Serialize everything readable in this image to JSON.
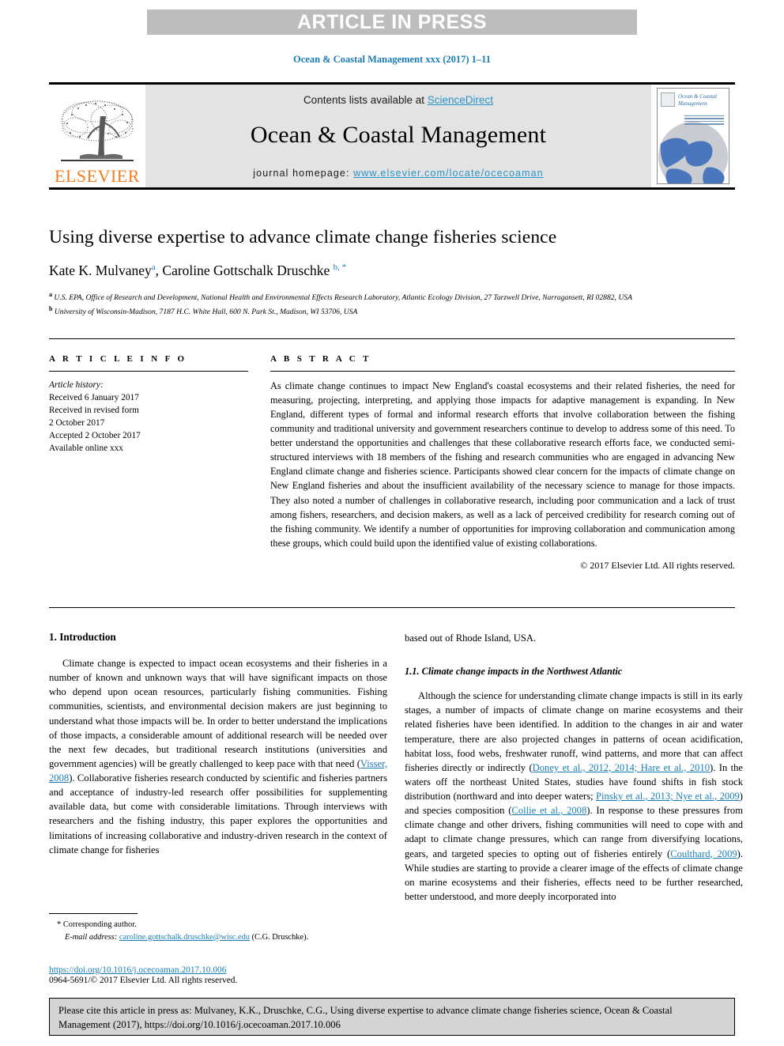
{
  "banner": {
    "text": "ARTICLE IN PRESS"
  },
  "running_head": "Ocean & Coastal Management xxx (2017) 1–11",
  "masthead": {
    "publisher_name": "ELSEVIER",
    "contents_prefix": "Contents lists available at ",
    "sciencedirect": "ScienceDirect",
    "journal_title": "Ocean & Coastal Management",
    "homepage_prefix": "journal homepage: ",
    "homepage_url": "www.elsevier.com/locate/ocecoaman",
    "cover_title": "Ocean & Coastal Management"
  },
  "article": {
    "title": "Using diverse expertise to advance climate change fisheries science",
    "authors": "Kate K. Mulvaney, Caroline Gottschalk Druschke",
    "author_1_name": "Kate K. Mulvaney",
    "author_1_sup": "a",
    "author_2_name": "Caroline Gottschalk Druschke",
    "author_2_sup": "b, *",
    "affiliation_a_marker": "a",
    "affiliation_a": "U.S. EPA, Office of Research and Development, National Health and Environmental Effects Research Laboratory, Atlantic Ecology Division, 27 Tarzwell Drive, Narragansett, RI 02882, USA",
    "affiliation_b_marker": "b",
    "affiliation_b": "University of Wisconsin-Madison, 7187 H.C. White Hall, 600 N. Park St., Madison, WI 53706, USA"
  },
  "article_info": {
    "label": "A R T I C L E   I N F O",
    "history_heading": "Article history:",
    "received": "Received 6 January 2017",
    "revised_line1": "Received in revised form",
    "revised_line2": "2 October 2017",
    "accepted": "Accepted 2 October 2017",
    "available": "Available online xxx"
  },
  "abstract": {
    "label": "A B S T R A C T",
    "text": "As climate change continues to impact New England's coastal ecosystems and their related fisheries, the need for measuring, projecting, interpreting, and applying those impacts for adaptive management is expanding. In New England, different types of formal and informal research efforts that involve collaboration between the fishing community and traditional university and government researchers continue to develop to address some of this need. To better understand the opportunities and challenges that these collaborative research efforts face, we conducted semi-structured interviews with 18 members of the fishing and research communities who are engaged in advancing New England climate change and fisheries science. Participants showed clear concern for the impacts of climate change on New England fisheries and about the insufficient availability of the necessary science to manage for those impacts. They also noted a number of challenges in collaborative research, including poor communication and a lack of trust among fishers, researchers, and decision makers, as well as a lack of perceived credibility for research coming out of the fishing community. We identify a number of opportunities for improving collaboration and communication among these groups, which could build upon the identified value of existing collaborations.",
    "copyright": "© 2017 Elsevier Ltd. All rights reserved."
  },
  "body": {
    "section1_heading": "1. Introduction",
    "section1_para1_part1": "Climate change is expected to impact ocean ecosystems and their fisheries in a number of known and unknown ways that will have significant impacts on those who depend upon ocean resources, particularly fishing communities. Fishing communities, scientists, and environmental decision makers are just beginning to understand what those impacts will be. In order to better understand the implications of those impacts, a considerable amount of additional research will be needed over the next few decades, but traditional research institutions (universities and government agencies) will be greatly challenged to keep pace with that need (",
    "citation_visser": "Visser, 2008",
    "section1_para1_part2": "). Collaborative fisheries research conducted by scientific and fisheries partners and acceptance of industry-led research offer possibilities for supplementing available data, but come with considerable limitations. Through interviews with researchers and the fishing industry, this paper explores the opportunities and limitations of increasing collaborative and industry-driven research in the context of climate change for fisheries",
    "section1_para1_cont": "based out of Rhode Island, USA.",
    "section11_heading": "1.1. Climate change impacts in the Northwest Atlantic",
    "section11_part1": "Although the science for understanding climate change impacts is still in its early stages, a number of impacts of climate change on marine ecosystems and their related fisheries have been identified. In addition to the changes in air and water temperature, there are also projected changes in patterns of ocean acidification, habitat loss, food webs, freshwater runoff, wind patterns, and more that can affect fisheries directly or indirectly (",
    "citation_doney_hare": "Doney et al., 2012, 2014; Hare et al., 2010",
    "section11_part2": "). In the waters off the northeast United States, studies have found shifts in fish stock distribution (northward and into deeper waters; ",
    "citation_pinsky_nye": "Pinsky et al., 2013; Nye et al., 2009",
    "section11_part3": ") and species composition (",
    "citation_collie": "Collie et al., 2008",
    "section11_part4": "). In response to these pressures from climate change and other drivers, fishing communities will need to cope with and adapt to climate change pressures, which can range from diversifying locations, gears, and targeted species to opting out of fisheries entirely (",
    "citation_coulthard": "Coulthard, 2009",
    "section11_part5": "). While studies are starting to provide a clearer image of the effects of climate change on marine ecosystems and their fisheries, effects need to be further researched, better understood, and more deeply incorporated into"
  },
  "footnotes": {
    "corresponding_marker": "*",
    "corresponding_label": "Corresponding author.",
    "email_label": "E-mail address:",
    "email_address": "caroline.gottschalk.druschke@wisc.edu",
    "email_attribution": "(C.G. Druschke).",
    "doi_url": "https://doi.org/10.1016/j.ocecoaman.2017.10.006",
    "issn_line": "0964-5691/© 2017 Elsevier Ltd. All rights reserved."
  },
  "cite_box": {
    "text": "Please cite this article in press as: Mulvaney, K.K., Druschke, C.G., Using diverse expertise to advance climate change fisheries science, Ocean & Coastal Management (2017), https://doi.org/10.1016/j.ocecoaman.2017.10.006"
  },
  "colors": {
    "link_blue": "#1a7db5",
    "sciencedirect_blue": "#2a93c9",
    "elsevier_orange": "#f47c20",
    "banner_gray": "#bdbdbd",
    "masthead_gray": "#e3e3e3",
    "cite_box_gray": "#d4d4d4"
  }
}
